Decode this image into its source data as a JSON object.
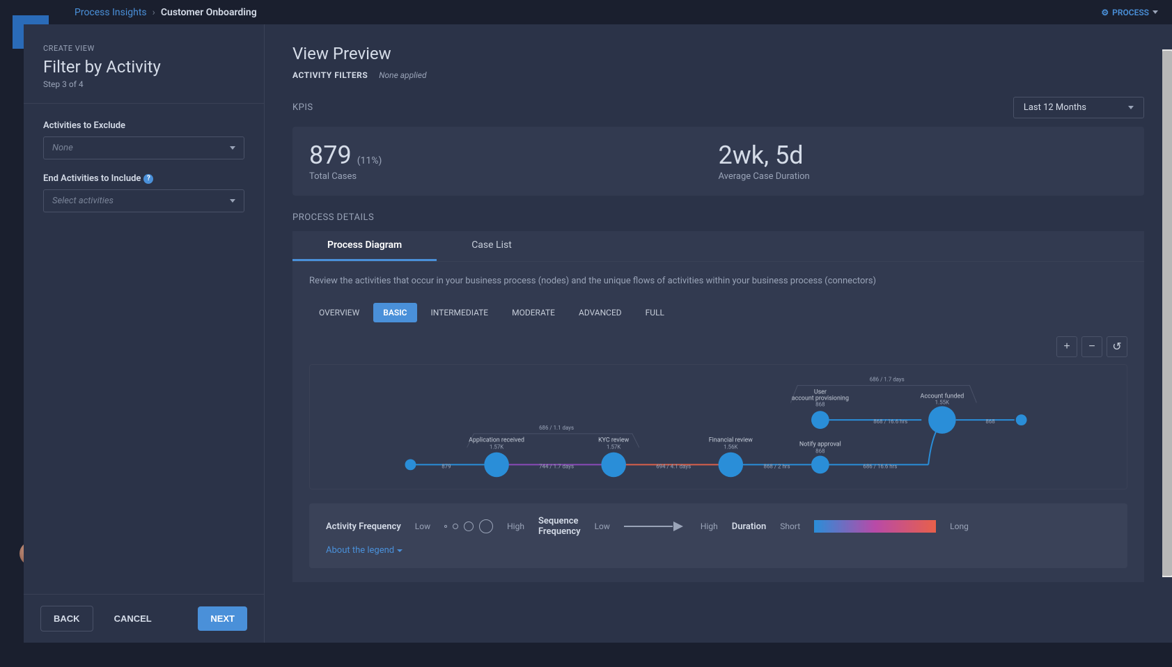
{
  "breadcrumb": {
    "link": "Process Insights",
    "current": "Customer Onboarding"
  },
  "topMenu": {
    "process": "PROCESS"
  },
  "logo": "ap",
  "leftPanel": {
    "createView": "CREATE VIEW",
    "title": "Filter by Activity",
    "step": "Step 3 of 4",
    "excludeLabel": "Activities to Exclude",
    "excludeValue": "None",
    "includeLabel": "End Activities to Include",
    "includeValue": "Select activities",
    "back": "BACK",
    "cancel": "CANCEL",
    "next": "NEXT"
  },
  "preview": {
    "title": "View Preview",
    "afLabel": "ACTIVITY FILTERS",
    "afValue": "None applied",
    "kpisLabel": "KPIS",
    "timeRange": "Last 12 Months",
    "kpi1Value": "879",
    "kpi1Pct": "(11%)",
    "kpi1Label": "Total Cases",
    "kpi2Value": "2wk, 5d",
    "kpi2Label": "Average Case Duration",
    "processDetails": "PROCESS DETAILS",
    "tabs": {
      "pd": "Process Diagram",
      "cl": "Case List"
    },
    "tabDesc": "Review the activities that occur in your business process (nodes) and the unique flows of activities within your business process (connectors)",
    "pills": {
      "overview": "OVERVIEW",
      "basic": "BASIC",
      "intermediate": "INTERMEDIATE",
      "moderate": "MODERATE",
      "advanced": "ADVANCED",
      "full": "FULL"
    },
    "legend": {
      "activityFreq": "Activity Frequency",
      "low": "Low",
      "high": "High",
      "seqFreq": "Sequence Frequency",
      "seqLine": "Sequence",
      "duration": "Duration",
      "short": "Short",
      "long": "Long",
      "about": "About the legend"
    }
  },
  "chart_data": {
    "type": "diagram",
    "nodes": [
      {
        "id": "start",
        "label": "",
        "count": 879
      },
      {
        "id": "app_received",
        "label": "Application received",
        "count": "1.57K"
      },
      {
        "id": "kyc",
        "label": "KYC review",
        "count": "1.57K"
      },
      {
        "id": "fin_review",
        "label": "Financial review",
        "count": "1.56K"
      },
      {
        "id": "notify",
        "label": "Notify approval",
        "count": 868
      },
      {
        "id": "user_prov",
        "label": "User account provisioning",
        "count": 868
      },
      {
        "id": "acct_funded",
        "label": "Account funded",
        "count": "1.55K"
      },
      {
        "id": "end",
        "label": "",
        "count": 868
      }
    ],
    "connectors": [
      {
        "from": "start",
        "to": "app_received",
        "label": "879"
      },
      {
        "from": "app_received",
        "to": "kyc",
        "label": "744 / 1.7 days"
      },
      {
        "from": "kyc",
        "to": "fin_review",
        "label": "694 / 4.1 days"
      },
      {
        "from": "fin_review",
        "to": "notify",
        "label": "868 / 2 hrs"
      },
      {
        "from": "notify",
        "to": "acct_funded",
        "label": "686 / 16.6 hrs"
      },
      {
        "from": "user_prov",
        "to": "acct_funded",
        "label": "868 / 16.6 hrs"
      },
      {
        "from": "acct_funded",
        "to": "end",
        "label": "868"
      },
      {
        "from": "app_received",
        "to": "kyc",
        "label": "686 / 1.1 days",
        "alt": true
      },
      {
        "from": "user_prov_top",
        "to": "acct_funded",
        "label": "686 / 1.7 days",
        "alt": true
      }
    ]
  }
}
